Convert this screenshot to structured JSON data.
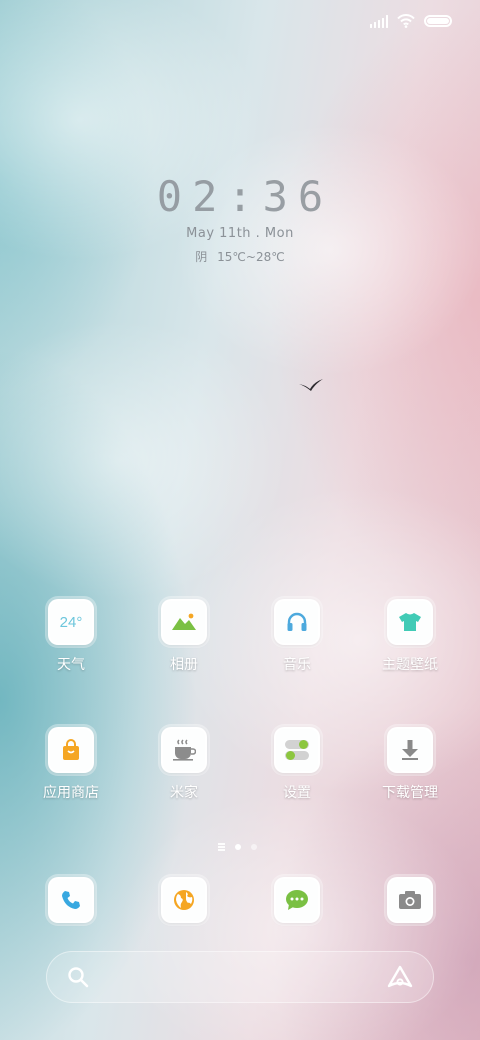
{
  "status_bar": {
    "icons": [
      "signal-icon",
      "wifi-icon",
      "battery-icon"
    ],
    "battery_level": 1.0
  },
  "lockscreen": {
    "time": "02:36",
    "date": "May   11th .  Mon",
    "weather_condition": "阴",
    "weather_range": "15℃~28℃"
  },
  "apps": [
    {
      "label": "天气",
      "icon": "weather-icon",
      "tile_text": "24°",
      "color": "#6cc6dc"
    },
    {
      "label": "相册",
      "icon": "gallery-icon",
      "color": "#7ac043"
    },
    {
      "label": "音乐",
      "icon": "headphones-icon",
      "color": "#4da9dd"
    },
    {
      "label": "主题壁纸",
      "icon": "tshirt-icon",
      "color": "#41cbb6"
    },
    {
      "label": "应用商店",
      "icon": "shopping-bag-icon",
      "color": "#f5a623"
    },
    {
      "label": "米家",
      "icon": "coffee-cup-icon",
      "color": "#8c8c8c"
    },
    {
      "label": "设置",
      "icon": "toggle-settings-icon",
      "color": "#8cc63f"
    },
    {
      "label": "下载管理",
      "icon": "download-arrow-icon",
      "color": "#8a8a8a"
    }
  ],
  "pager": {
    "pages": 3,
    "active": 1
  },
  "dock": [
    {
      "icon": "phone-icon",
      "color": "#38a8e0"
    },
    {
      "icon": "browser-globe-icon",
      "color": "#f5a623"
    },
    {
      "icon": "message-icon",
      "color": "#7ac043"
    },
    {
      "icon": "camera-icon",
      "color": "#8a8a8a"
    }
  ],
  "search": {
    "left_icon": "search-icon",
    "right_icon": "assistant-icon"
  }
}
